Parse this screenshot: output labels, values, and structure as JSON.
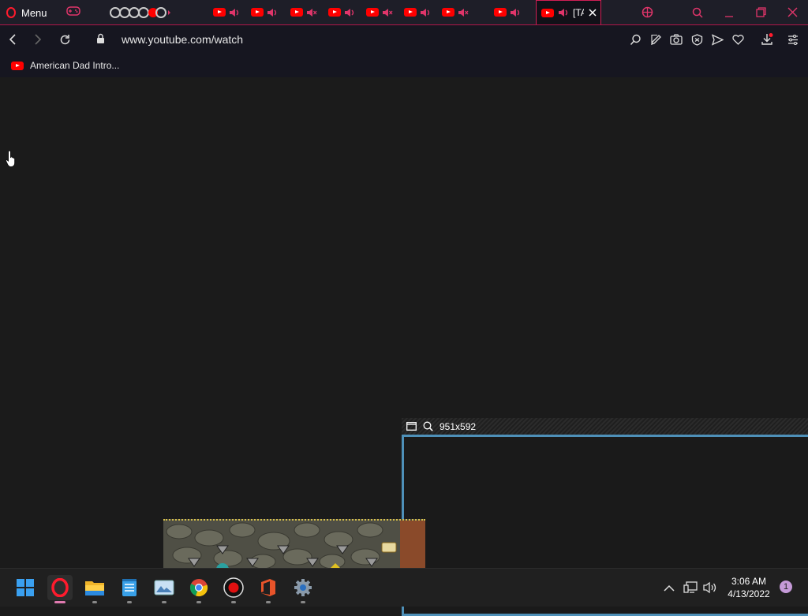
{
  "browser": {
    "menu_label": "Menu",
    "active_tab_title": "[TAS]",
    "url": "www.youtube.com/watch",
    "accent": "#ff1b2d"
  },
  "tabs": [
    {
      "icon": "youtube-icon",
      "audio": "playing"
    },
    {
      "icon": "youtube-icon",
      "audio": "playing"
    },
    {
      "icon": "youtube-icon",
      "audio": "muted"
    },
    {
      "icon": "youtube-icon",
      "audio": "playing"
    },
    {
      "icon": "youtube-icon",
      "audio": "muted"
    },
    {
      "icon": "youtube-icon",
      "audio": "playing"
    },
    {
      "icon": "youtube-icon",
      "audio": "muted"
    },
    {
      "icon": "youtube-icon",
      "audio": "playing"
    }
  ],
  "bookmarks": [
    {
      "label": "American Dad Intro...",
      "icon": "youtube-icon"
    }
  ],
  "snip": {
    "dimensions": "951x592",
    "frame_color": "#4e90b8"
  },
  "taskbar": {
    "apps": [
      "windows-start-icon",
      "opera-icon",
      "file-explorer-icon",
      "notepad-icon",
      "photos-icon",
      "chrome-icon",
      "obs-record-icon",
      "office-icon",
      "settings-icon"
    ],
    "time": "3:06 AM",
    "date": "4/13/2022",
    "notifications": "1"
  }
}
